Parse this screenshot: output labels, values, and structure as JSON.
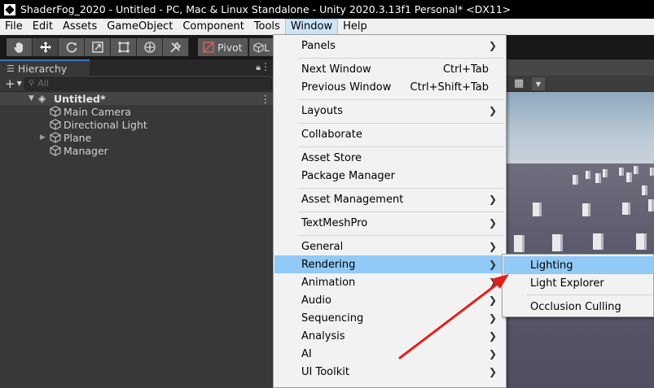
{
  "window": {
    "title": "ShaderFog_2020 - Untitled - PC, Mac & Linux Standalone - Unity 2020.3.13f1 Personal* <DX11>"
  },
  "menubar": {
    "items": [
      "File",
      "Edit",
      "Assets",
      "GameObject",
      "Component",
      "Tools",
      "Window",
      "Help"
    ],
    "active": "Window"
  },
  "toolbar": {
    "pivot_label": "Pivot",
    "local_label": "L"
  },
  "hierarchy": {
    "tab_label": "Hierarchy",
    "search_placeholder": "All",
    "scene_name": "Untitled*",
    "items": [
      {
        "label": "Main Camera",
        "expandable": false
      },
      {
        "label": "Directional Light",
        "expandable": false
      },
      {
        "label": "Plane",
        "expandable": true
      },
      {
        "label": "Manager",
        "expandable": false
      }
    ]
  },
  "window_menu": {
    "items": [
      {
        "label": "Panels",
        "submenu": true
      },
      {
        "label": "Next Window",
        "shortcut": "Ctrl+Tab"
      },
      {
        "label": "Previous Window",
        "shortcut": "Ctrl+Shift+Tab"
      },
      {
        "label": "Layouts",
        "submenu": true
      },
      {
        "label": "Collaborate"
      },
      {
        "label": "Asset Store"
      },
      {
        "label": "Package Manager"
      },
      {
        "label": "Asset Management",
        "submenu": true
      },
      {
        "label": "TextMeshPro",
        "submenu": true
      },
      {
        "label": "General",
        "submenu": true
      },
      {
        "label": "Rendering",
        "submenu": true,
        "highlighted": true
      },
      {
        "label": "Animation",
        "submenu": true
      },
      {
        "label": "Audio",
        "submenu": true
      },
      {
        "label": "Sequencing",
        "submenu": true
      },
      {
        "label": "Analysis",
        "submenu": true
      },
      {
        "label": "AI",
        "submenu": true
      },
      {
        "label": "UI Toolkit",
        "submenu": true
      }
    ]
  },
  "rendering_submenu": {
    "items": [
      {
        "label": "Lighting",
        "highlighted": true
      },
      {
        "label": "Light Explorer"
      },
      {
        "label": "Occlusion Culling"
      }
    ]
  },
  "icons": {
    "toolbar": [
      "hand-tool-icon",
      "move-tool-icon",
      "rotate-tool-icon",
      "scale-tool-icon",
      "rect-tool-icon",
      "transform-tool-icon",
      "custom-tool-icon"
    ],
    "submenu_arrow": "chevron-right-icon",
    "object": "cube-icon"
  },
  "colors": {
    "menu_highlight": "#91c9f7",
    "annotation_arrow": "#e02020",
    "titlebar": "#000000",
    "editor_bg": "#383838"
  }
}
